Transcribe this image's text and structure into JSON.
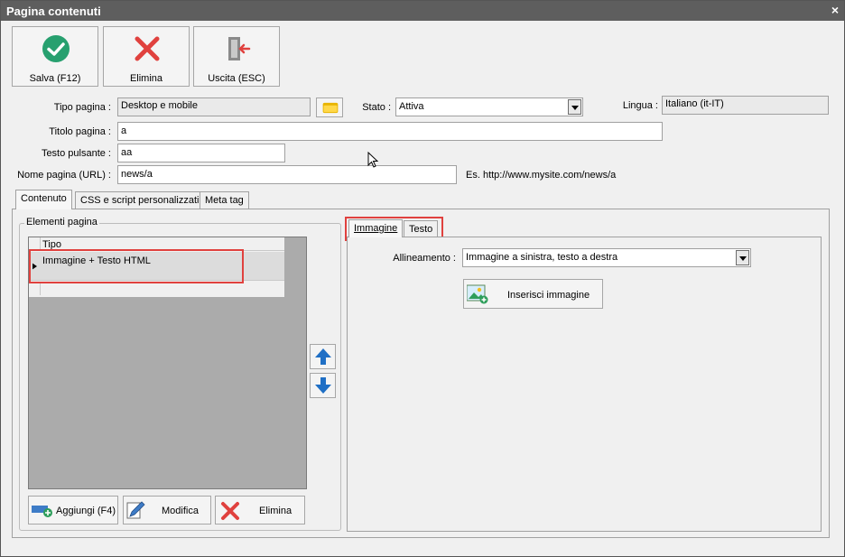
{
  "window": {
    "title": "Pagina contenuti",
    "close": "×"
  },
  "toolbar": {
    "save_label": "Salva (F12)",
    "delete_label": "Elimina",
    "exit_label": "Uscita (ESC)"
  },
  "form": {
    "tipo_pagina_label": "Tipo pagina :",
    "tipo_pagina_value": "Desktop e mobile",
    "stato_label": "Stato :",
    "stato_value": "Attiva",
    "lingua_label": "Lingua :",
    "lingua_value": "Italiano (it-IT)",
    "titolo_label": "Titolo pagina :",
    "titolo_value": "a",
    "testo_pulsante_label": "Testo pulsante :",
    "testo_pulsante_value": "aa",
    "nome_pagina_label": "Nome pagina (URL) :",
    "nome_pagina_value": "news/a",
    "url_example": "Es. http://www.mysite.com/news/a"
  },
  "tabs": [
    "Contenuto",
    "CSS e script personalizzati",
    "Meta tag"
  ],
  "elementi": {
    "group_title": "Elementi pagina",
    "column_header": "Tipo",
    "rows": [
      "Immagine + Testo HTML"
    ],
    "add_label": "Aggiungi (F4)",
    "edit_label": "Modifica",
    "delete_label": "Elimina"
  },
  "detail": {
    "tabs": [
      "Immagine",
      "Testo"
    ],
    "allineamento_label": "Allineamento :",
    "allineamento_value": "Immagine a sinistra, testo a destra",
    "insert_image_label": "Inserisci immagine"
  },
  "colors": {
    "title_bar": "#5e5e5e",
    "highlight": "#e0413e",
    "accent_blue": "#1f6fc5"
  }
}
